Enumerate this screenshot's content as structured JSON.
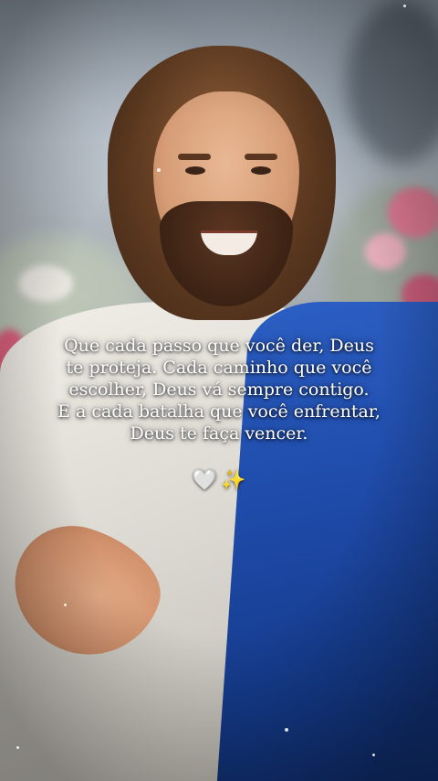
{
  "quote": {
    "lines": [
      "Que cada passo que você der, Deus",
      "te proteja. Cada caminho que você",
      "escolher, Deus vá sempre contigo.",
      "E a cada batalha que você enfrentar,",
      "Deus te faça vencer."
    ]
  },
  "emoji": {
    "heart": "🤍",
    "sparkles": "✨"
  },
  "colors": {
    "text": "#ffffff",
    "mantle": "#1e4aa8",
    "robe": "#e6e3dc"
  }
}
